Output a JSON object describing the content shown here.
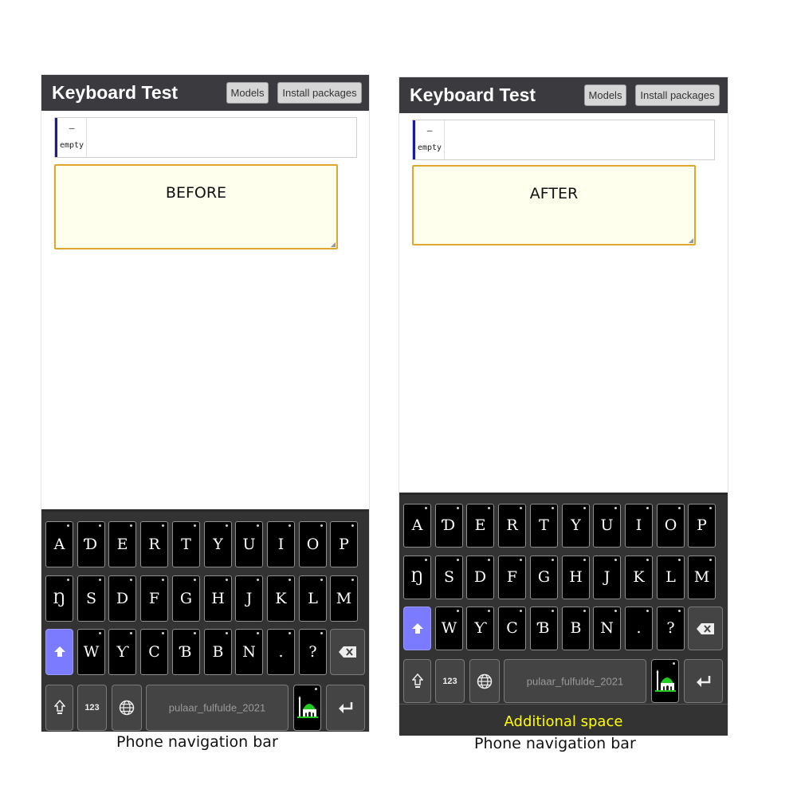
{
  "header": {
    "title": "Keyboard Test",
    "models_label": "Models",
    "install_label": "Install packages"
  },
  "keyboard_info": {
    "dash": "–",
    "empty": "empty"
  },
  "screens": {
    "before": {
      "text": "BEFORE"
    },
    "after": {
      "text": "AFTER",
      "additional_space": "Additional space"
    }
  },
  "keyboard": {
    "row1": [
      "A",
      "Ɗ",
      "E",
      "R",
      "T",
      "Y",
      "U",
      "I",
      "O",
      "P"
    ],
    "row2": [
      "Ŋ",
      "S",
      "D",
      "F",
      "G",
      "H",
      "J",
      "K",
      "L",
      "M"
    ],
    "row3": [
      "W",
      "Ƴ",
      "C",
      "Ɓ",
      "B",
      "N",
      ".",
      "?"
    ],
    "numeric_label": "123",
    "space_label": "pulaar_fulfulde_2021",
    "icons": {
      "shift": "shift-arrow-icon",
      "backspace": "backspace-icon",
      "caps": "caps-lock-icon",
      "globe": "globe-icon",
      "mosque": "mosque-icon",
      "enter": "enter-icon"
    }
  },
  "captions": {
    "nav_bar": "Phone navigation bar"
  },
  "colors": {
    "header_bg": "#3a3a3f",
    "keyboard_bg": "#333333",
    "shift_active": "#7b7bff",
    "textbox_bg": "#ffffee",
    "textbox_border": "#e0a72c",
    "additional_space_text": "#ffff00"
  }
}
